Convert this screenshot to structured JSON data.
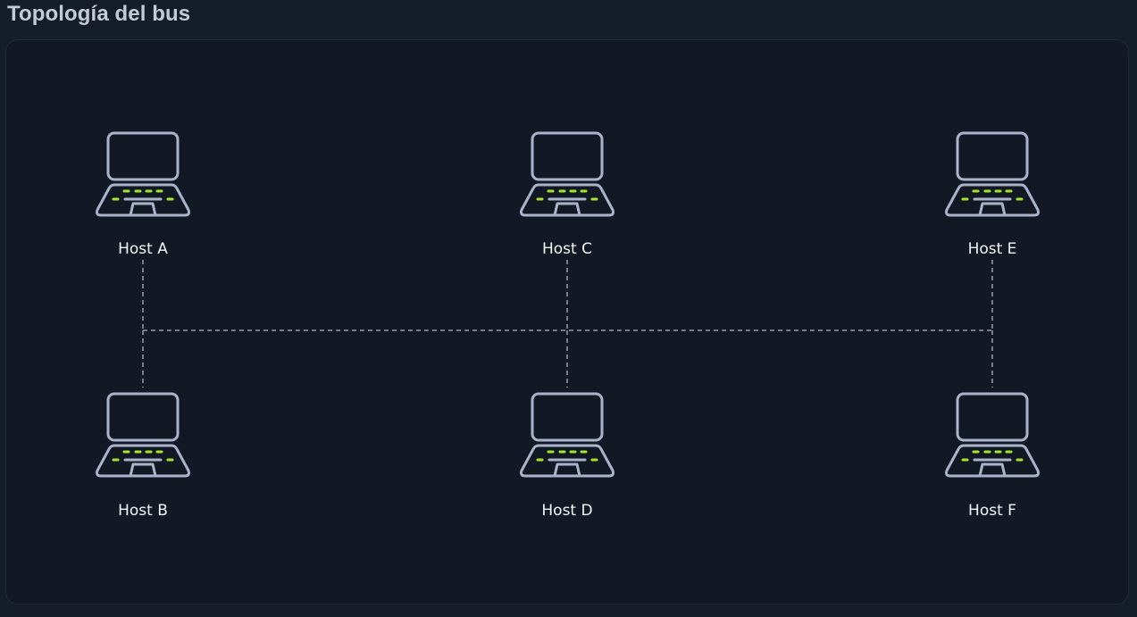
{
  "title": "Topología del bus",
  "colors": {
    "background": "#151d29",
    "panel": "#121925",
    "device_outline": "#a9b4cc",
    "keyboard_accent": "#a6e22e",
    "bus_line": "#aab4c6",
    "label": "#f3f5f8"
  },
  "hosts": [
    {
      "id": "a",
      "label": "Host A",
      "icon": "laptop-icon"
    },
    {
      "id": "b",
      "label": "Host B",
      "icon": "laptop-icon"
    },
    {
      "id": "c",
      "label": "Host C",
      "icon": "laptop-icon"
    },
    {
      "id": "d",
      "label": "Host D",
      "icon": "laptop-icon"
    },
    {
      "id": "e",
      "label": "Host E",
      "icon": "laptop-icon"
    },
    {
      "id": "f",
      "label": "Host F",
      "icon": "laptop-icon"
    }
  ],
  "connections": {
    "type": "bus",
    "style": "dashed",
    "members": [
      "a",
      "b",
      "c",
      "d",
      "e",
      "f"
    ]
  }
}
